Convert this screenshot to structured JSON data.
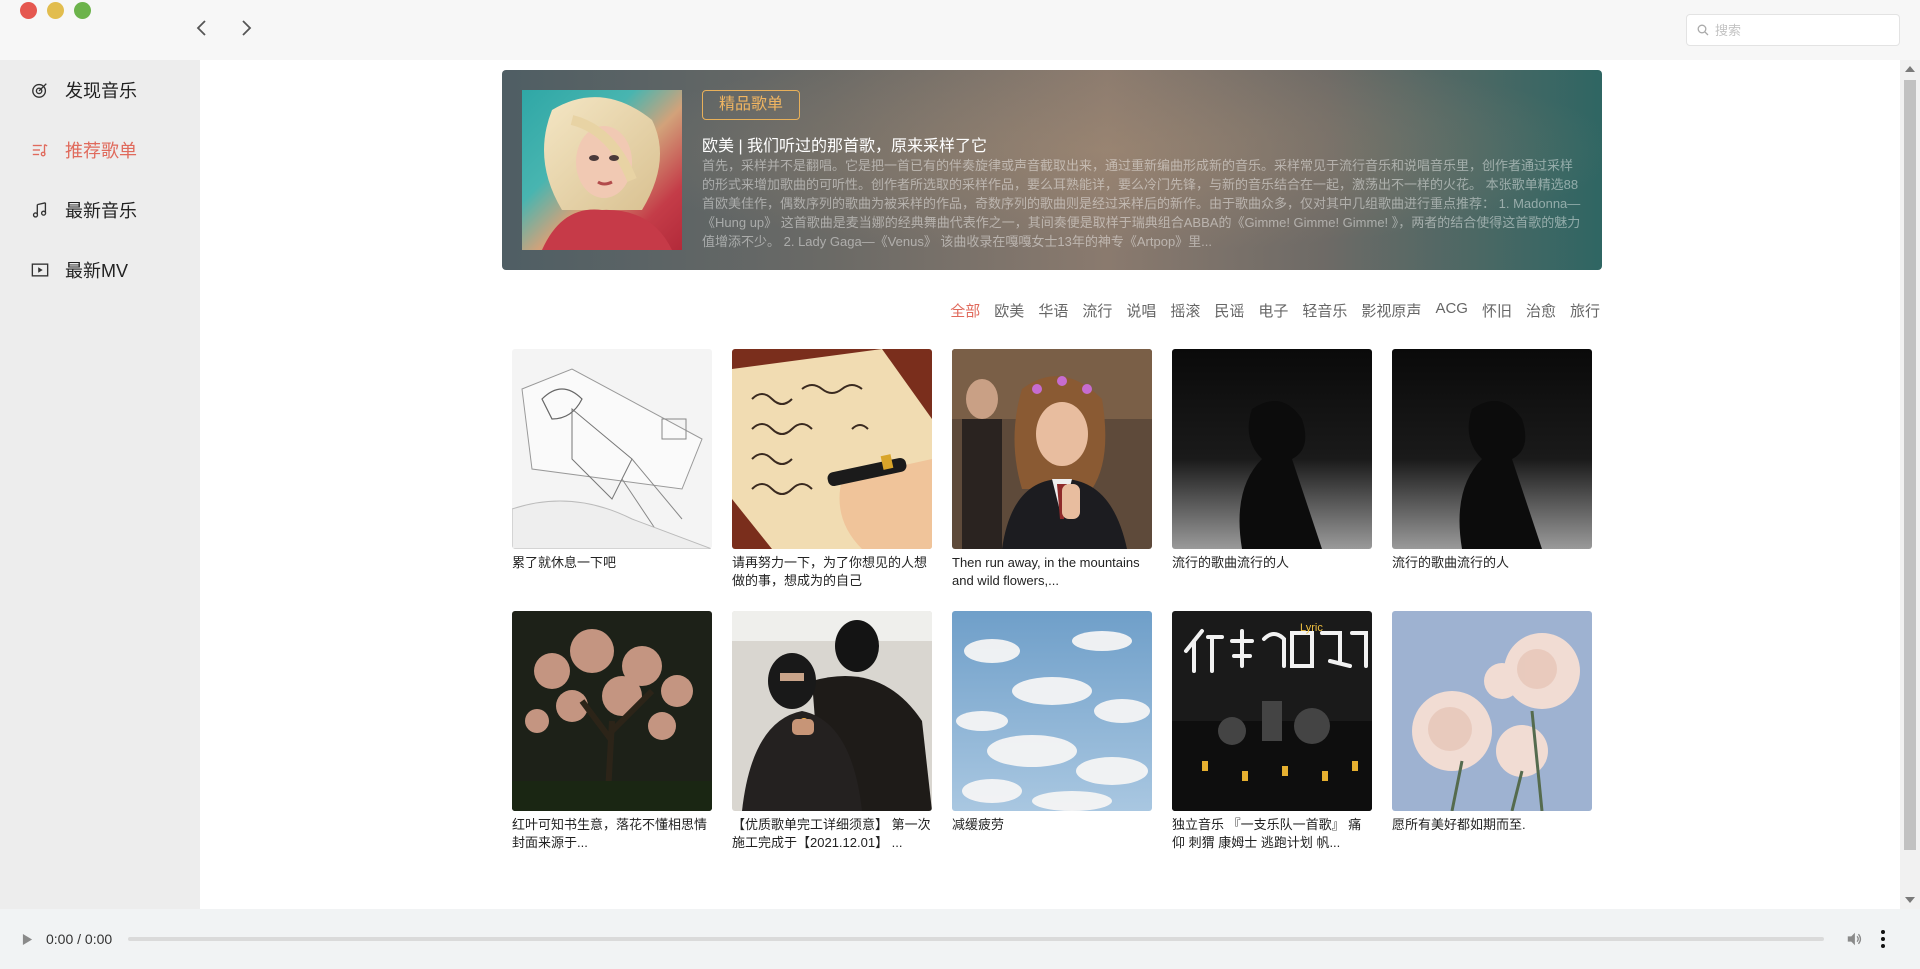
{
  "window": {
    "controls": [
      "close",
      "minimize",
      "maximize"
    ]
  },
  "nav": {
    "back_icon": "chevron-left-icon",
    "forward_icon": "chevron-right-icon"
  },
  "search": {
    "placeholder": "搜索",
    "value": ""
  },
  "sidebar": {
    "items": [
      {
        "label": "发现音乐",
        "icon": "target-icon",
        "active": false
      },
      {
        "label": "推荐歌单",
        "icon": "playlist-icon",
        "active": true
      },
      {
        "label": "最新音乐",
        "icon": "music-note-icon",
        "active": false
      },
      {
        "label": "最新MV",
        "icon": "video-play-icon",
        "active": false
      }
    ]
  },
  "banner": {
    "tag": "精品歌单",
    "title": "欧美 | 我们听过的那首歌，原来采样了它",
    "description": "首先，采样并不是翻唱。它是把一首已有的伴奏旋律或声音截取出来，通过重新编曲形成新的音乐。采样常见于流行音乐和说唱音乐里，创作者通过采样的形式来增加歌曲的可听性。创作者所选取的采样作品，要么耳熟能详，要么冷门先锋，与新的音乐结合在一起，激荡出不一样的火花。 本张歌单精选88首欧美佳作，偶数序列的歌曲为被采样的作品，奇数序列的歌曲则是经过采样后的新作。由于歌曲众多，仅对其中几组歌曲进行重点推荐： 1. Madonna—《Hung up》 这首歌曲是麦当娜的经典舞曲代表作之一，其间奏便是取样于瑞典组合ABBA的《Gimme! Gimme! Gimme! 》，两者的结合使得这首歌的魅力值增添不少。 2. Lady Gaga—《Venus》 该曲收录在嘎嘎女士13年的神专《Artpop》里..."
  },
  "categories": {
    "active_index": 0,
    "items": [
      "全部",
      "欧美",
      "华语",
      "流行",
      "说唱",
      "摇滚",
      "民谣",
      "电子",
      "轻音乐",
      "影视原声",
      "ACG",
      "怀旧",
      "治愈",
      "旅行"
    ]
  },
  "playlists": [
    {
      "title": "累了就休息一下吧"
    },
    {
      "title": "请再努力一下，为了你想见的人想做的事，想成为的自己"
    },
    {
      "title": "Then run away, in the mountains and wild flowers,..."
    },
    {
      "title": "流行的歌曲流行的人"
    },
    {
      "title": "流行的歌曲流行的人"
    },
    {
      "title": "红叶可知书生意，落花不懂相思情 封面来源于..."
    },
    {
      "title": "【优质歌单完工详细须意】 第一次施工完成于【2021.12.01】 ..."
    },
    {
      "title": "减缓疲劳"
    },
    {
      "title": "独立音乐 『一支乐队一首歌』 痛仰 刺猬 康姆士 逃跑计划 帆..."
    },
    {
      "title": "愿所有美好都如期而至."
    }
  ],
  "player": {
    "time": "0:00 / 0:00",
    "progress": 0
  },
  "colors": {
    "accent": "#e06a5c",
    "tag_gold": "#f0b561",
    "sidebar_bg": "#ededed"
  }
}
